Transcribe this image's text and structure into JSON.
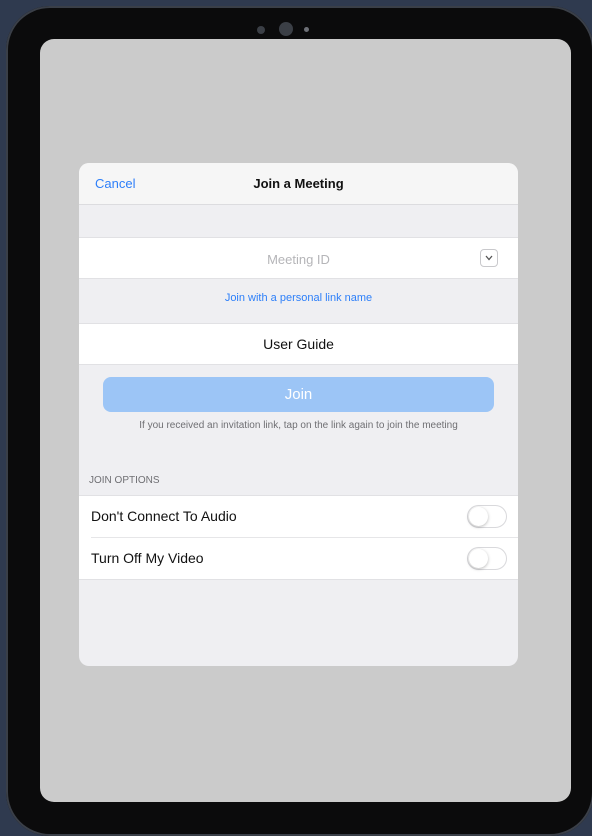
{
  "nav": {
    "cancel_label": "Cancel",
    "title": "Join a Meeting"
  },
  "meeting_id": {
    "placeholder": "Meeting ID",
    "value": ""
  },
  "personal_link": "Join with a personal link name",
  "user_name": "User Guide",
  "join": {
    "label": "Join",
    "hint": "If you received an invitation link, tap on the link again to join the meeting"
  },
  "join_options": {
    "section_label": "JOIN OPTIONS",
    "items": [
      {
        "label": "Don't Connect To Audio",
        "enabled": false
      },
      {
        "label": "Turn Off My Video",
        "enabled": false
      }
    ]
  },
  "colors": {
    "accent": "#2d7ff9",
    "join_button": "#9cc5f6",
    "screen_dim": "#cbcbcb"
  }
}
